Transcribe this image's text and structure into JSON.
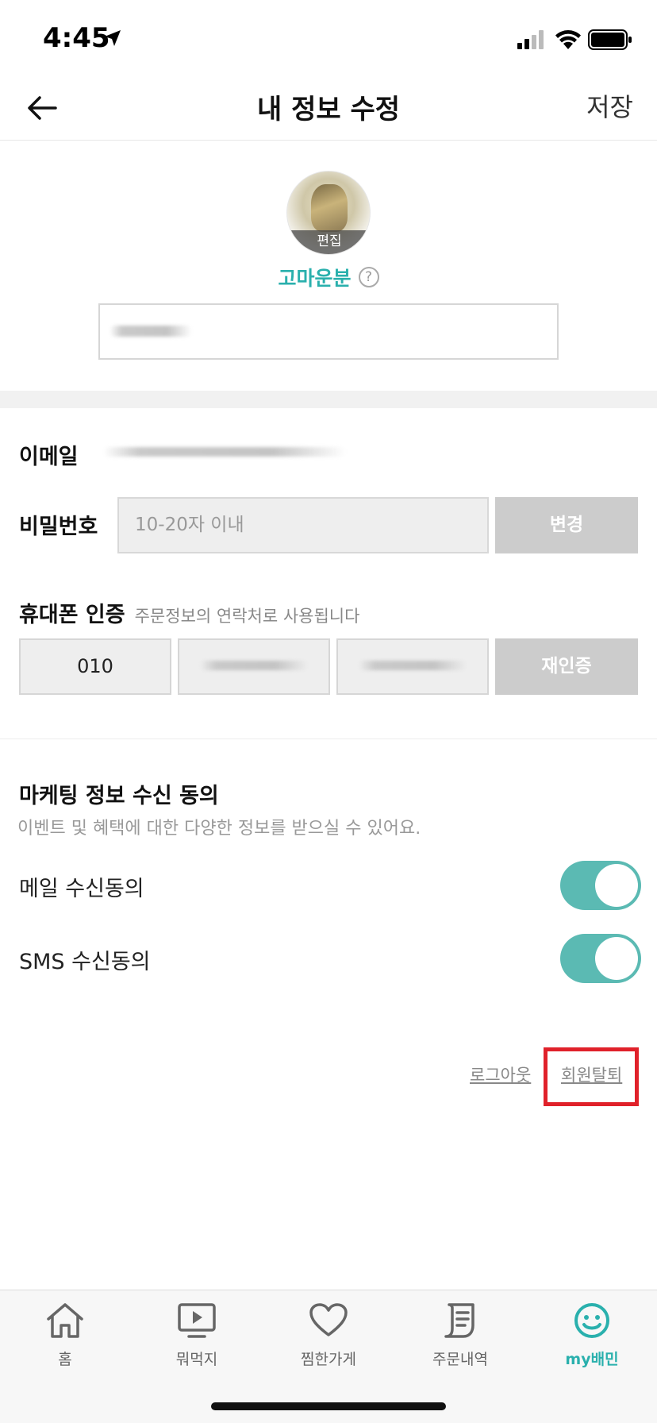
{
  "status_bar": {
    "time": "4:45"
  },
  "nav": {
    "title": "내 정보 수정",
    "save_label": "저장"
  },
  "profile": {
    "avatar_edit_label": "편집",
    "nickname": "고마운분",
    "help_icon": "?"
  },
  "account": {
    "email_label": "이메일",
    "password_label": "비밀번호",
    "password_placeholder": "10-20자 이내",
    "password_change_label": "변경",
    "phone_label": "휴대폰 인증",
    "phone_desc": "주문정보의 연락처로 사용됩니다",
    "phone_prefix": "010",
    "reverify_label": "재인증"
  },
  "marketing": {
    "title": "마케팅 정보 수신 동의",
    "desc": "이벤트 및 혜택에 대한 다양한 정보를 받으실 수 있어요.",
    "email_consent_label": "메일 수신동의",
    "email_consent_on": true,
    "sms_consent_label": "SMS 수신동의",
    "sms_consent_on": true
  },
  "footer_links": {
    "logout": "로그아웃",
    "withdraw": "회원탈퇴"
  },
  "tabs": [
    {
      "label": "홈",
      "icon": "home-icon"
    },
    {
      "label": "뭐먹지",
      "icon": "play-screen-icon"
    },
    {
      "label": "찜한가게",
      "icon": "heart-icon"
    },
    {
      "label": "주문내역",
      "icon": "receipt-icon"
    },
    {
      "label": "my배민",
      "icon": "smiley-icon",
      "active": true
    }
  ],
  "colors": {
    "accent": "#2ab0ad",
    "toggle_on": "#5bbab3",
    "highlight": "#e0212a"
  }
}
